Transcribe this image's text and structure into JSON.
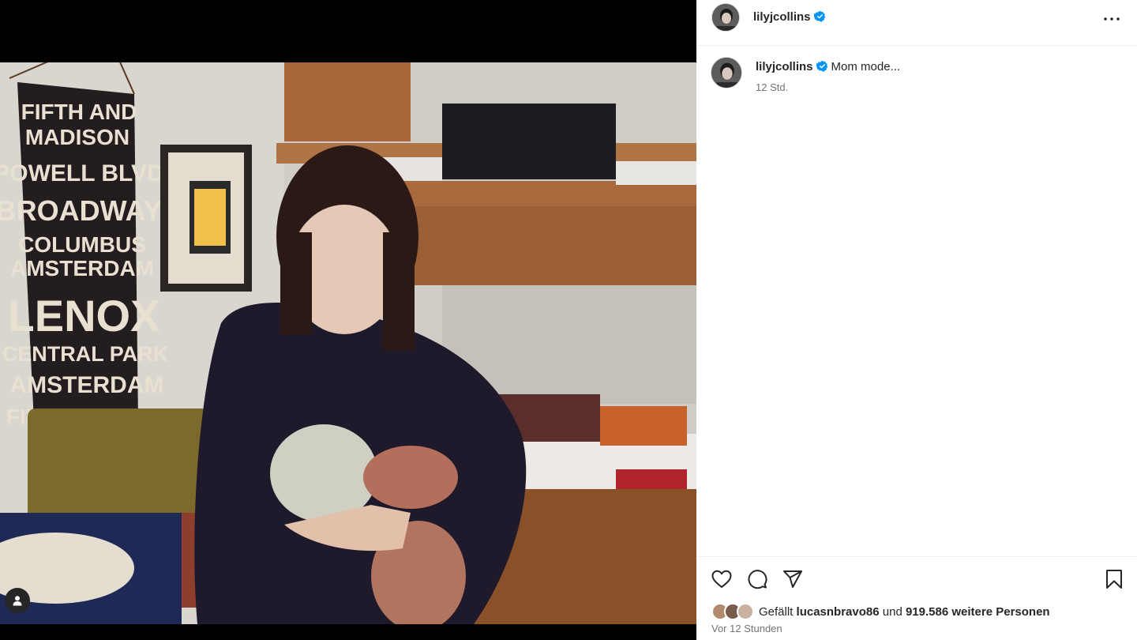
{
  "post": {
    "username": "lilyjcollins",
    "verified": true,
    "caption": "Mom mode...",
    "caption_time": "12 Std.",
    "likes_prefix": "Gefällt",
    "liked_by": "lucasnbravo86",
    "likes_joiner": "und",
    "likes_others": "919.586 weitere Personen",
    "posted_time": "Vor 12 Stunden"
  },
  "photo": {
    "sign_lines": [
      "FIFTH AND",
      "MADISON",
      "POWELL BLVD",
      "BROADWAY",
      "COLUMBUS",
      "AMSTERDAM",
      "LENOX",
      "CENTRAL PARK",
      "AMSTERDAM",
      "FIRST SECOND"
    ]
  },
  "icons": {
    "header": [
      "avatar",
      "verified-badge-icon",
      "more-options-icon"
    ],
    "actions": [
      "heart-icon",
      "comment-icon",
      "share-icon",
      "bookmark-icon"
    ],
    "media": [
      "user-tag-icon"
    ]
  },
  "colors": {
    "verified": "#0095f6",
    "text": "#262626",
    "secondary": "#737373",
    "divider": "#efefef"
  }
}
